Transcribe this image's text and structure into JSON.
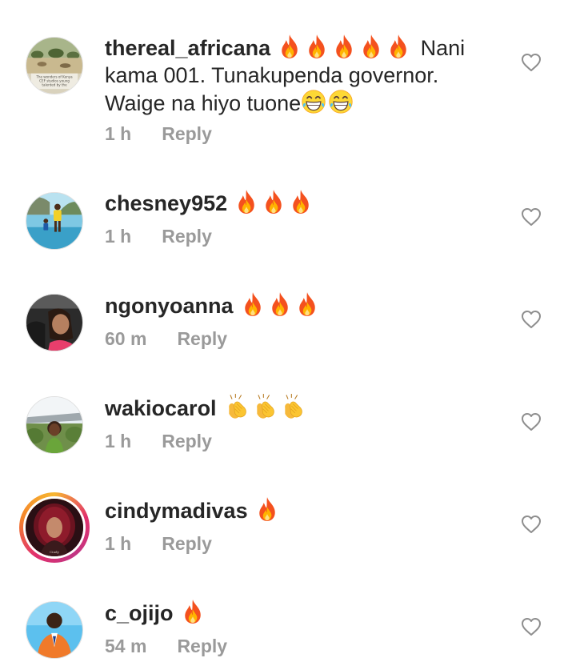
{
  "comments": [
    {
      "username": "thereal_africana",
      "emojis": [
        "fire",
        "fire",
        "fire",
        "fire",
        "fire"
      ],
      "text_line1": "Nani",
      "text_line2": "kama 001. Tunakupenda governor.",
      "text_line3": "Waige na hiyo tuone",
      "trailing_emojis": [
        "grin",
        "grin"
      ],
      "time": "1 h",
      "reply": "Reply",
      "avatar_text": "The wonders of Kenya CEF studios young talented by the willing by rolls",
      "avatar_icon": "landscape-avatar"
    },
    {
      "username": "chesney952",
      "emojis": [
        "fire",
        "fire",
        "fire"
      ],
      "time": "1 h",
      "reply": "Reply",
      "avatar_icon": "pool-avatar"
    },
    {
      "username": "ngonyoanna",
      "emojis": [
        "fire",
        "fire",
        "fire"
      ],
      "time": "60 m",
      "reply": "Reply",
      "avatar_icon": "selfie-avatar"
    },
    {
      "username": "wakiocarol",
      "emojis": [
        "clap",
        "clap",
        "clap"
      ],
      "time": "1 h",
      "reply": "Reply",
      "avatar_icon": "outdoor-avatar"
    },
    {
      "username": "cindymadivas",
      "emojis": [
        "fire"
      ],
      "time": "1 h",
      "reply": "Reply",
      "avatar_icon": "portrait-avatar",
      "has_story_ring": true
    },
    {
      "username": "c_ojijo",
      "emojis": [
        "fire"
      ],
      "time": "54 m",
      "reply": "Reply",
      "avatar_icon": "man-avatar"
    }
  ],
  "colors": {
    "text": "#262626",
    "meta": "#9a9a9a",
    "heart": "#8e8e8e",
    "story_ring": "#e1306c",
    "fire": "#f4511e"
  },
  "icons": {
    "like": "heart-outline-icon",
    "fire": "fire-emoji-icon",
    "clap": "clapping-hands-emoji-icon",
    "grin": "grinning-face-emoji-icon"
  }
}
